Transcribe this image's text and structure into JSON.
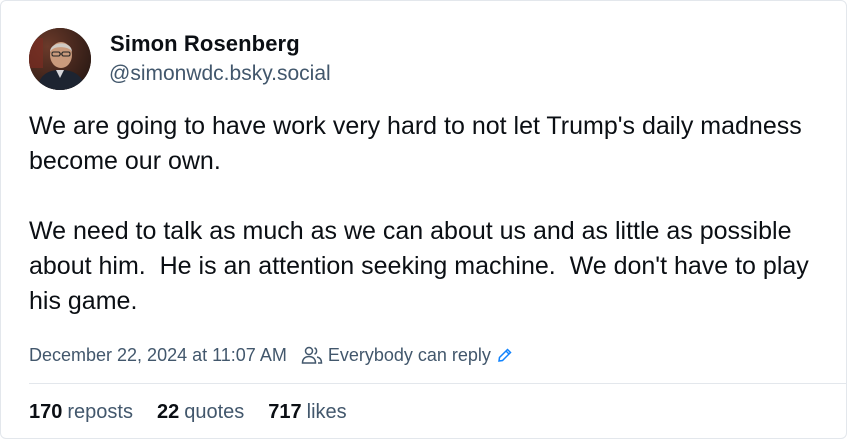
{
  "author": {
    "display_name": "Simon Rosenberg",
    "handle": "@simonwdc.bsky.social"
  },
  "post": {
    "paragraphs": [
      "We are going to have work very hard to not let Trump's daily madness become our own.",
      "We need to talk as much as we can about us and as little as possible about him.  He is an attention seeking machine.  We don't have to play his game."
    ],
    "timestamp": "December 22, 2024 at 11:07 AM",
    "reply_setting": "Everybody can reply"
  },
  "stats": {
    "reposts_count": "170",
    "reposts_label": "reposts",
    "quotes_count": "22",
    "quotes_label": "quotes",
    "likes_count": "717",
    "likes_label": "likes"
  },
  "colors": {
    "text_primary": "#0b0f14",
    "text_secondary": "#42576c",
    "accent": "#1083fe",
    "border": "#e3e7ec"
  },
  "icons": {
    "people": "people-icon",
    "edit": "pencil-icon"
  }
}
